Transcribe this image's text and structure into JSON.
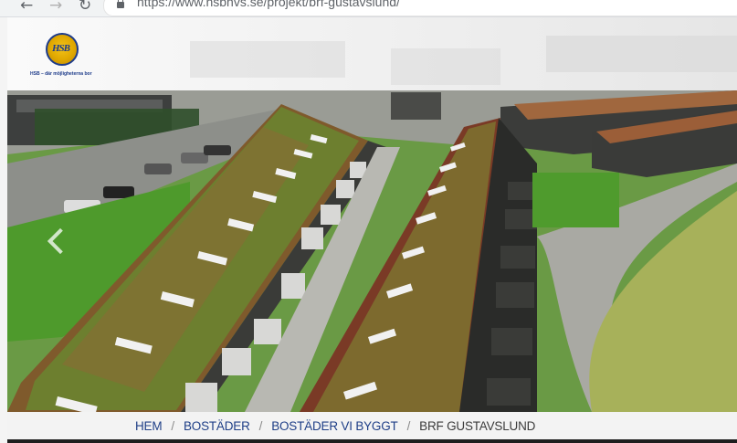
{
  "browser": {
    "back_icon": "arrow-left-icon",
    "forward_icon": "arrow-right-icon",
    "reload_icon": "reload-icon",
    "lock_icon": "lock-icon",
    "url": "https://www.hsbnvs.se/projekt/brf-gustavslund/"
  },
  "site": {
    "logo_text": "HSB",
    "tagline": "HSB – där möjligheterna bor",
    "accent": "#1f3f87",
    "logo_gold": "#e0a800"
  },
  "hero": {
    "image": "aerial-photo-green-roof-housing",
    "prev_icon": "chevron-left-icon"
  },
  "breadcrumb": {
    "home": "HEM",
    "level1": "BOSTÄDER",
    "level2": "BOSTÄDER VI BYGGT",
    "current": "BRF GUSTAVSLUND",
    "separator": "/"
  }
}
